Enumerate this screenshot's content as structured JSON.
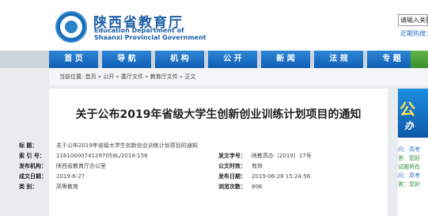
{
  "header": {
    "site_name_cn": "陕西省教育厅",
    "site_name_en1": "Education Department of",
    "site_name_en2": "Shaanxi Provincial Government",
    "search_value": "请输入关键",
    "recent_search": "近期热搜："
  },
  "nav": {
    "items": [
      "首  页",
      "导  航",
      "机  构",
      "公  开",
      "新  闻",
      "法  规",
      "专  题"
    ]
  },
  "breadcrumb": {
    "text": "当前位置: 首页 » 公开 » 委厅文件 » 教育厅文件 » 正文"
  },
  "article": {
    "title": "关于公布2019年省级大学生创新创业训练计划项目的通知",
    "meta": {
      "title_label": "标  题：",
      "title_value": "关于公布2019年省级大学生创新创业训练计划项目的通知",
      "index_label": "索 引 号：",
      "index_value": "11610000741297059L/2019-156",
      "doc_no_label": "发文字号：",
      "doc_no_value": "陕教高办〔2019〕17号",
      "publisher_label": "发布机构：",
      "publisher_value": "陕西省教育厅办公室",
      "open_label": "公文时效：",
      "open_value": "有效",
      "created_label": "成文日期：",
      "created_value": "2019-6-27",
      "published_label": "发布日期：",
      "published_value": "2019-06-28 15:24:56",
      "category_label": "类  别：",
      "category_value": "高等教育",
      "views_label": "浏览次数：",
      "views_value": "806"
    }
  },
  "side": {
    "banner_big": "公",
    "banner_small": "办",
    "lines": [
      "问：高考",
      "答：您好",
      "试题将在",
      "问：高考",
      "答：您好"
    ]
  },
  "colors": {
    "brand_blue": "#1e5fa8",
    "nav_blue": "#1a6cc4",
    "nav_green": "#4ca33a"
  }
}
